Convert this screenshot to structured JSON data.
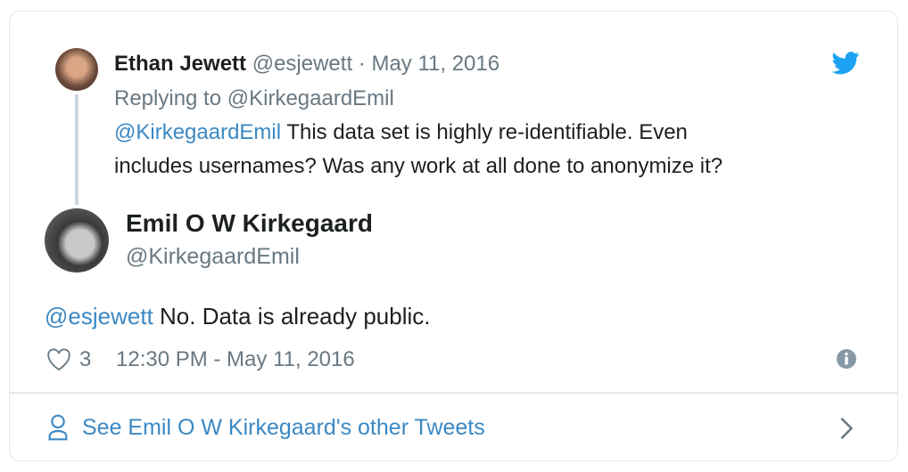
{
  "parent_tweet": {
    "author_name": "Ethan Jewett",
    "handle": "@esjewett",
    "separator": "·",
    "date": "May 11, 2016",
    "replying_prefix": "Replying to",
    "replying_to": "@KirkegaardEmil",
    "mention": "@KirkegaardEmil",
    "text_line1": " This data set is highly re-identifiable. Even",
    "text_line2": "includes usernames? Was any work at all done to anonymize it?"
  },
  "tweet": {
    "author_name": "Emil O W Kirkegaard",
    "handle": "@KirkegaardEmil",
    "mention": "@esjewett",
    "text": " No. Data is already public.",
    "likes": "3",
    "timestamp": "12:30 PM - May 11, 2016"
  },
  "footer": {
    "link_label": "See Emil O W Kirkegaard's other Tweets"
  },
  "colors": {
    "link": "#3b88c3",
    "text": "#1c2022",
    "muted": "#697882",
    "twitter": "#1da1f2"
  }
}
